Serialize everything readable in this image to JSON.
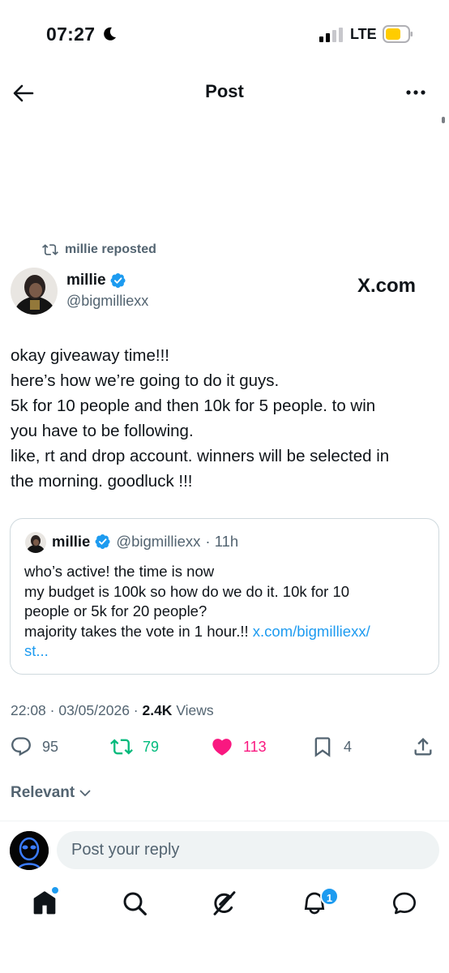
{
  "status_bar": {
    "time": "07:27",
    "network": "LTE"
  },
  "header": {
    "title": "Post"
  },
  "repost": {
    "text": "millie reposted"
  },
  "author": {
    "name": "millie",
    "handle": "@bigmilliexx",
    "badge": "X.com"
  },
  "post": {
    "lines": [
      "okay giveaway time!!!",
      "here’s how we’re going to do it guys.",
      "5k for 10 people and then 10k for 5 people. to win",
      "you have to be following.",
      "like, rt and drop account. winners will be selected in",
      "the morning. goodluck !!!"
    ]
  },
  "quote": {
    "name": "millie",
    "handle": "@bigmilliexx",
    "time": "· 11h",
    "lines": [
      "who’s active! the time is now",
      "my budget is 100k so how do we do it. 10k for 10",
      "people or 5k for 20 people?"
    ],
    "last_line": "majority takes the vote in 1 hour.!! ",
    "link_part1": "x.com/bigmilliexx/",
    "link_part2": "st..."
  },
  "meta": {
    "timestamp": "22:08 · 03/05/2026 · ",
    "views_count": "2.4K",
    "views_label": " Views"
  },
  "actions": {
    "replies": "95",
    "reposts": "79",
    "likes": "113",
    "bookmarks": "4"
  },
  "sort": {
    "label": "Relevant"
  },
  "reply_box": {
    "placeholder": "Post your reply"
  },
  "nav": {
    "notifications_badge": "1"
  },
  "colors": {
    "accent": "#1d9bf0",
    "repost_green": "#00ba7c",
    "like_pink": "#f91880",
    "muted": "#536471"
  }
}
